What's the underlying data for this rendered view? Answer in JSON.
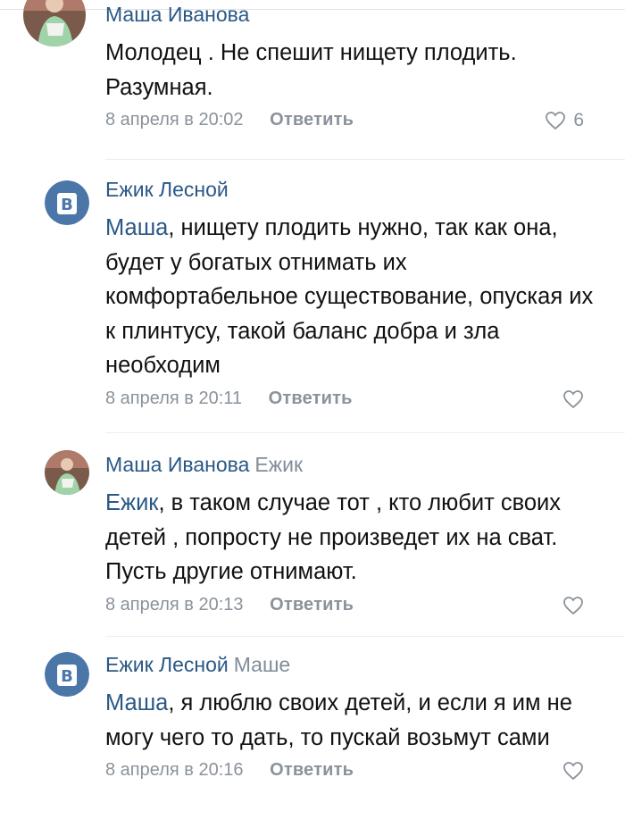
{
  "comments": [
    {
      "author": "Маша Иванова",
      "reply_to": "",
      "mention": "",
      "text": "Молодец . Не спешит нищету плодить. Разумная.",
      "date": "8 апреля в 20:02",
      "reply_label": "Ответить",
      "likes": "6"
    },
    {
      "author": "Ежик Лесной",
      "reply_to": "",
      "mention": "Маша",
      "text": ", нищету плодить нужно, так как она, будет у богатых отнимать их комфортабельное существование, опуская их к плинтусу, такой баланс добра и зла необходим",
      "date": "8 апреля в 20:11",
      "reply_label": "Ответить",
      "likes": ""
    },
    {
      "author": "Маша Иванова",
      "reply_to": "Ежик",
      "mention": "Ежик",
      "text": ", в таком случае тот , кто любит своих детей , попросту не произведет их на сват. Пусть другие отнимают.",
      "date": "8 апреля в 20:13",
      "reply_label": "Ответить",
      "likes": ""
    },
    {
      "author": "Ежик Лесной",
      "reply_to": "Маше",
      "mention": "Маша",
      "text": ", я люблю своих детей, и если я им не могу чего то дать, то пускай возьмут сами",
      "date": "8 апреля в 20:16",
      "reply_label": "Ответить",
      "likes": ""
    }
  ],
  "icons": {
    "like": "heart-outline-icon",
    "avatar_masha": "avatar-photo",
    "avatar_ezhik": "vk-logo-icon"
  },
  "colors": {
    "author": "#2a5885",
    "meta": "#8a929b",
    "vk_blue": "#4a76a8"
  }
}
